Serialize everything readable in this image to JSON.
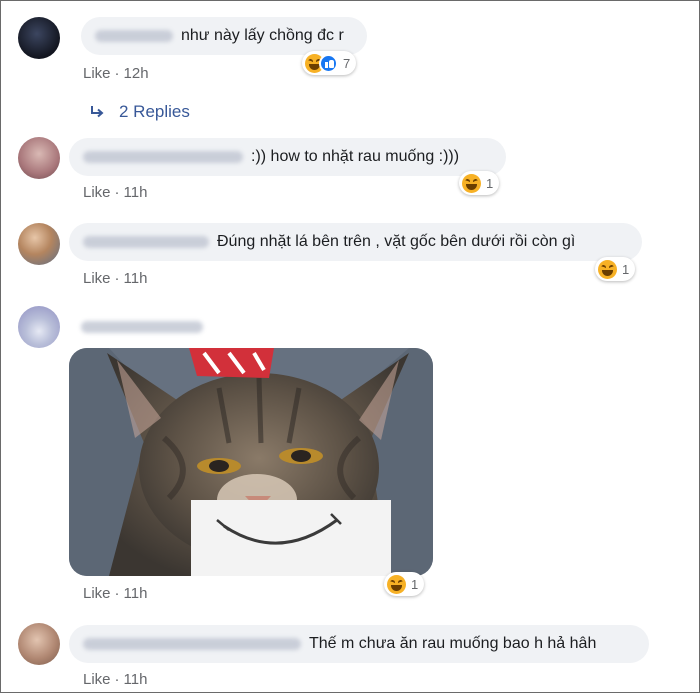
{
  "comments": [
    {
      "text": "như này lấy chồng đc r",
      "like_label": "Like",
      "time": "12h",
      "reaction_count": "7",
      "replies_label": "2 Replies"
    },
    {
      "text": ":)) how to nhặt rau muống :)))",
      "like_label": "Like",
      "time": "11h",
      "reaction_count": "1"
    },
    {
      "text": "Đúng nhặt lá bên trên , vặt gốc bên dưới rồi còn gì",
      "like_label": "Like",
      "time": "11h",
      "reaction_count": "1"
    },
    {
      "like_label": "Like",
      "time": "11h",
      "reaction_count": "1"
    },
    {
      "text": "Thế m chưa ăn rau muống bao h hả hâh",
      "like_label": "Like",
      "time": "11h"
    }
  ],
  "icons": {
    "reaction": "haha-icon",
    "like_reaction": "like-reaction-icon",
    "reply_arrow": "reply-arrow-icon"
  },
  "colors": {
    "bubble": "#f0f2f5",
    "link": "#385898",
    "meta": "#65676b",
    "like_blue": "#1877f2",
    "haha_yellow": "#f7b125"
  }
}
